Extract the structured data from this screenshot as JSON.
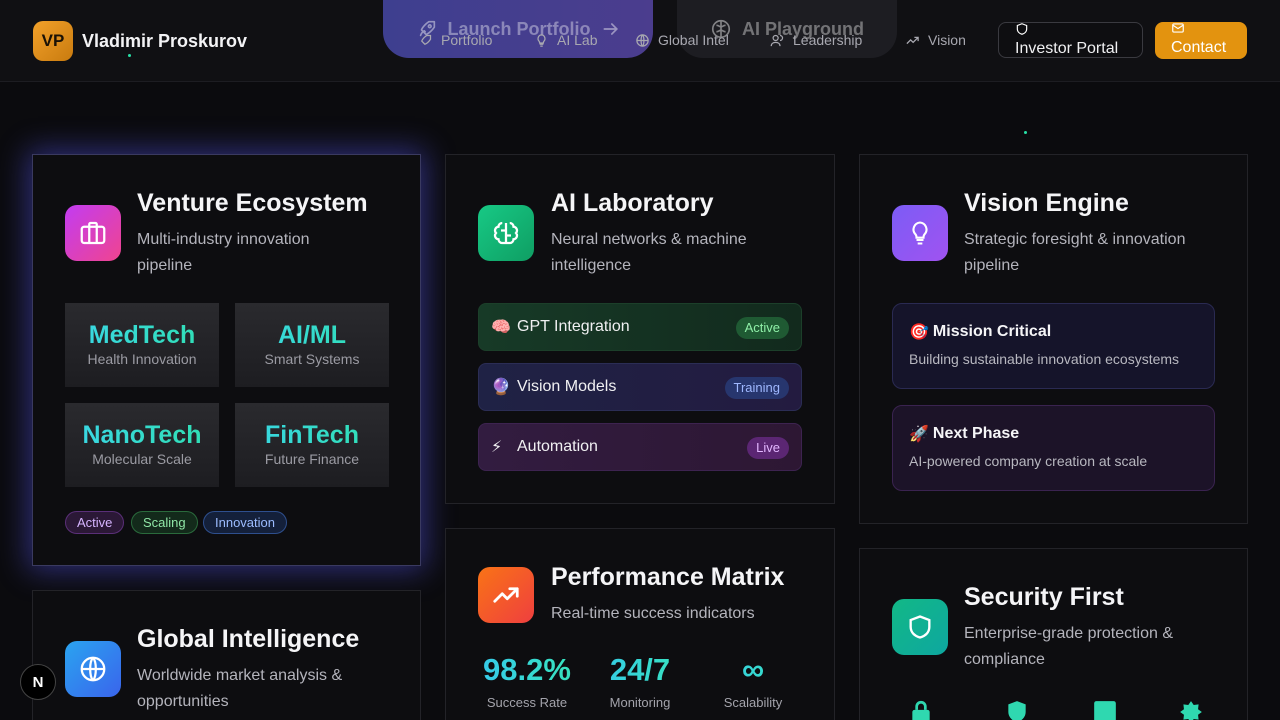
{
  "brand": {
    "logo_text": "VP",
    "name": "Vladimir Proskurov"
  },
  "overlay_buttons": {
    "launch": "Launch Portfolio",
    "ai_playground": "AI Playground"
  },
  "nav": {
    "items": [
      {
        "label": "Portfolio",
        "icon": "rocket-icon"
      },
      {
        "label": "AI Lab",
        "icon": "lightbulb-icon"
      },
      {
        "label": "Global Intel",
        "icon": "globe-icon"
      },
      {
        "label": "Leadership",
        "icon": "users-icon"
      },
      {
        "label": "Vision",
        "icon": "trending-up-icon"
      }
    ],
    "investor_portal": "Investor Portal",
    "contact": "Contact"
  },
  "venture": {
    "title": "Venture Ecosystem",
    "subtitle": "Multi-industry innovation pipeline",
    "tiles": [
      {
        "name": "MedTech",
        "desc": "Health Innovation"
      },
      {
        "name": "AI/ML",
        "desc": "Smart Systems"
      },
      {
        "name": "NanoTech",
        "desc": "Molecular Scale"
      },
      {
        "name": "FinTech",
        "desc": "Future Finance"
      }
    ],
    "tags": [
      "Active",
      "Scaling",
      "Innovation"
    ]
  },
  "ai_lab": {
    "title": "AI Laboratory",
    "subtitle": "Neural networks & machine intelligence",
    "rows": [
      {
        "emoji": "🧠",
        "label": "GPT Integration",
        "status": "Active"
      },
      {
        "emoji": "🔮",
        "label": "Vision Models",
        "status": "Training"
      },
      {
        "emoji": "⚡",
        "label": "Automation",
        "status": "Live"
      }
    ]
  },
  "vision": {
    "title": "Vision Engine",
    "subtitle": "Strategic foresight & innovation pipeline",
    "boxes": [
      {
        "emoji": "🎯",
        "title": "Mission Critical",
        "desc": "Building sustainable innovation ecosystems"
      },
      {
        "emoji": "🚀",
        "title": "Next Phase",
        "desc": "AI-powered company creation at scale"
      }
    ]
  },
  "global": {
    "title": "Global Intelligence",
    "subtitle": "Worldwide market analysis & opportunities"
  },
  "performance": {
    "title": "Performance Matrix",
    "subtitle": "Real-time success indicators",
    "metrics": [
      {
        "value": "98.2%",
        "label": "Success Rate"
      },
      {
        "value": "24/7",
        "label": "Monitoring"
      },
      {
        "value": "∞",
        "label": "Scalability"
      }
    ]
  },
  "security": {
    "title": "Security First",
    "subtitle": "Enterprise-grade protection & compliance",
    "icons": [
      "lock-icon",
      "shield-icon",
      "server-icon",
      "badge-icon"
    ]
  },
  "next_badge": "N",
  "colors": {
    "accent_orange": "#e3930f",
    "tile_text": "#3bd6e8",
    "venture_icon": "#d946ef",
    "ai_icon": "#10b981",
    "vision_icon": "#8b5cf6",
    "global_icon": "#3b82f6",
    "performance_icon": "#f97316",
    "security_icon": "#14b8a6"
  }
}
